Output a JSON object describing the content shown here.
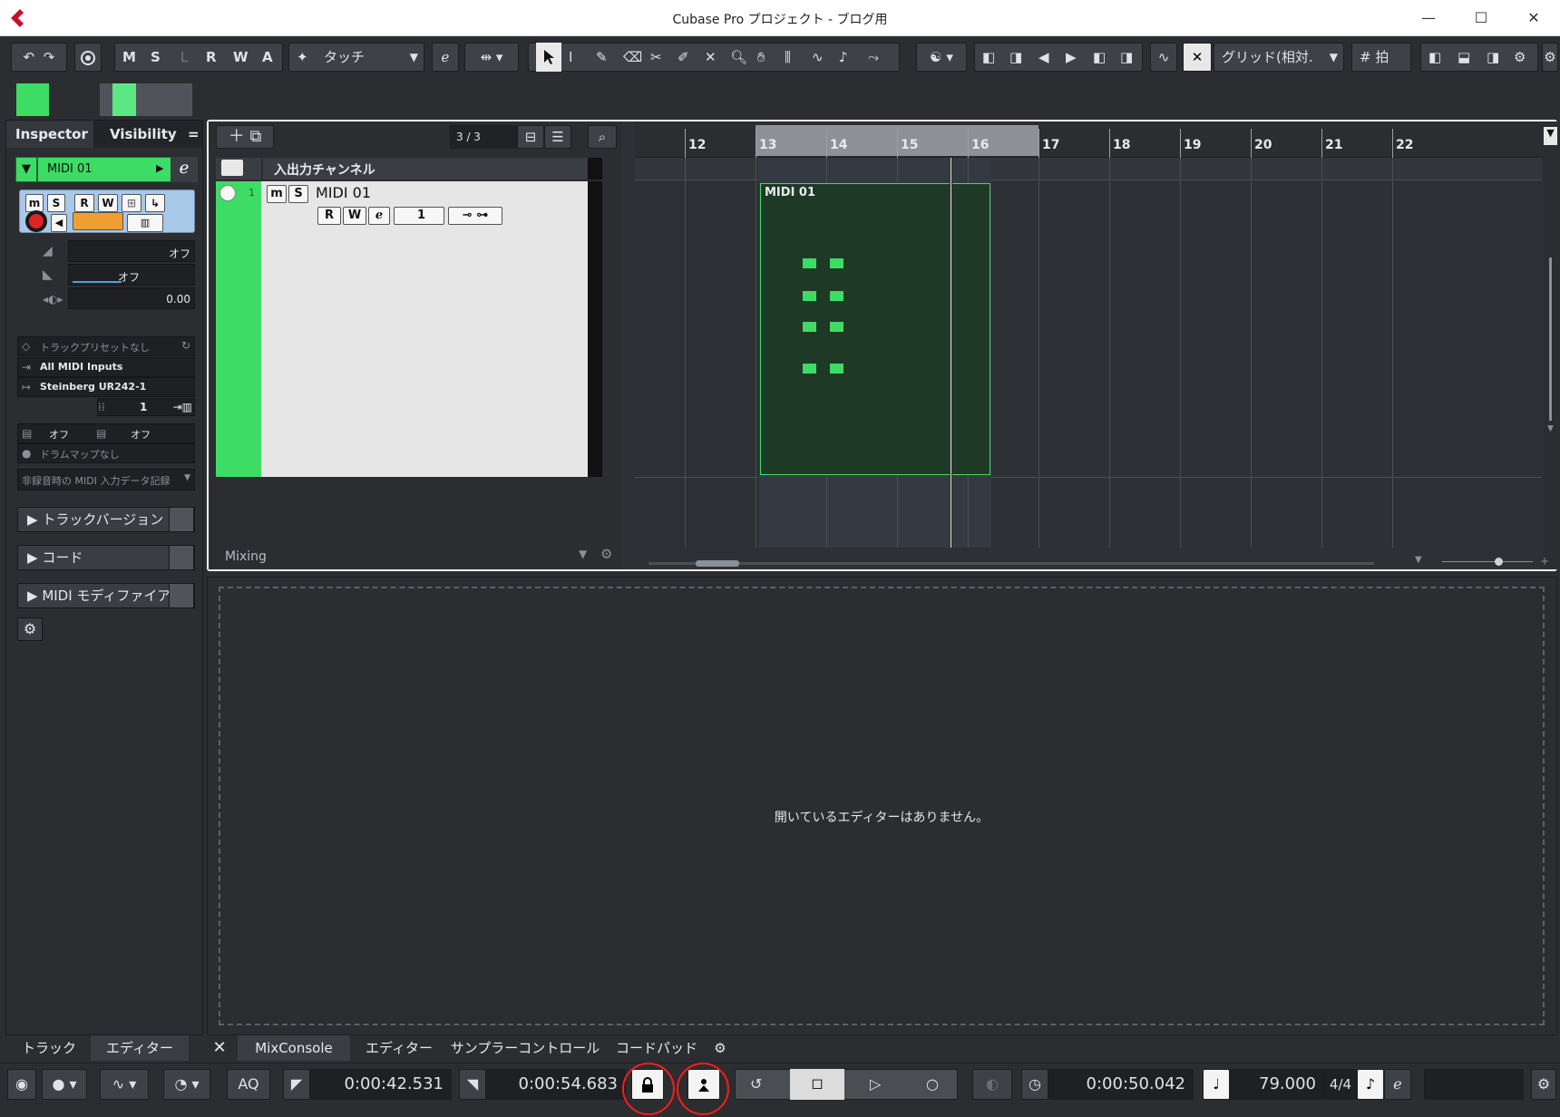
{
  "window": {
    "title": "Cubase Pro プロジェクト - ブログ用",
    "minimize_glyph": "—",
    "maximize_glyph": "☐",
    "close_glyph": "✕"
  },
  "toolbar": {
    "m_label": "M",
    "s_label": "S",
    "l_label": "L",
    "r_label": "R",
    "w_label": "W",
    "a_label": "A",
    "automation_mode": "タッチ",
    "grid_type": "グリッド(相対.",
    "quantize": "拍"
  },
  "inspector": {
    "tab_inspector": "Inspector",
    "tab_visibility": "Visibility",
    "track_name": "MIDI 01",
    "volume_value": "オフ",
    "pan_value": "オフ",
    "delay_value": "0.00",
    "preset": "トラックプリセットなし",
    "input": "All MIDI Inputs",
    "output": "Steinberg UR242-1",
    "channel": "1",
    "bank_value": "オフ",
    "program_value": "オフ",
    "drum_map": "ドラムマップなし",
    "midi_record_mode": "非録音時の MIDI 入力データ記録",
    "sections": [
      "トラックバージョン",
      "コード",
      "MIDI モディファイアー"
    ]
  },
  "tracklist": {
    "count": "3 / 3",
    "folder_name": "入出力チャンネル",
    "track_number": "1",
    "track_name": "MIDI 01",
    "track_channel": "1",
    "footer": "Mixing"
  },
  "ruler": {
    "bars": [
      "12",
      "13",
      "14",
      "15",
      "16",
      "17",
      "18",
      "19",
      "20",
      "21",
      "22"
    ]
  },
  "event": {
    "name": "MIDI 01"
  },
  "editor": {
    "empty_message": "開いているエディターはありません。"
  },
  "bottom_tabs": [
    "トラック",
    "エディター",
    "MixConsole",
    "エディター",
    "サンプラーコントロール",
    "コードパッド"
  ],
  "transport": {
    "aq": "AQ",
    "left_locator": "0:00:42.531",
    "right_locator": "0:00:54.683",
    "position": "0:00:50.042",
    "tempo": "79.000",
    "signature": "4/4"
  },
  "colors": {
    "track_green": "#3ddc64",
    "annotation_red": "#ff1a1a"
  }
}
